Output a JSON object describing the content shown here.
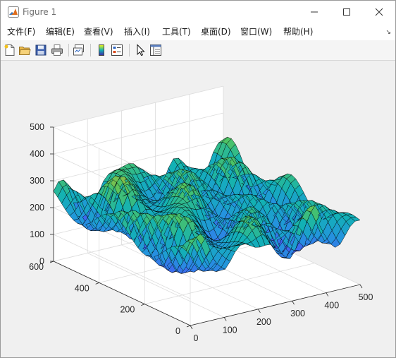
{
  "window": {
    "title": "Figure 1",
    "controls": [
      "minimize",
      "maximize",
      "close"
    ]
  },
  "menu": {
    "items": [
      "文件(F)",
      "编辑(E)",
      "查看(V)",
      "插入(I)",
      "工具(T)",
      "桌面(D)",
      "窗口(W)",
      "帮助(H)"
    ],
    "overflow_icon": "dock-arrow-icon"
  },
  "toolbar": {
    "icons": [
      "new-figure-icon",
      "open-file-icon",
      "save-icon",
      "print-icon",
      "link-plot-icon",
      "insert-colorbar-icon",
      "insert-legend-icon",
      "pointer-icon",
      "property-inspector-icon"
    ]
  },
  "chart_data": {
    "type": "surface",
    "title": "",
    "xlabel": "",
    "ylabel": "",
    "zlabel": "",
    "xlim": [
      0,
      500
    ],
    "ylim": [
      0,
      600
    ],
    "zlim": [
      0,
      500
    ],
    "xticks": [
      "0",
      "100",
      "200",
      "300",
      "400",
      "500"
    ],
    "yticks": [
      "0",
      "200",
      "400",
      "600"
    ],
    "zticks": [
      "0",
      "100",
      "200",
      "300",
      "400",
      "500"
    ],
    "grid": true,
    "colormap": "parula",
    "colors": {
      "low": "#3e26a8",
      "mid": "#12b1b5",
      "high": "#f9fb0e",
      "mesh": "#000000"
    }
  }
}
